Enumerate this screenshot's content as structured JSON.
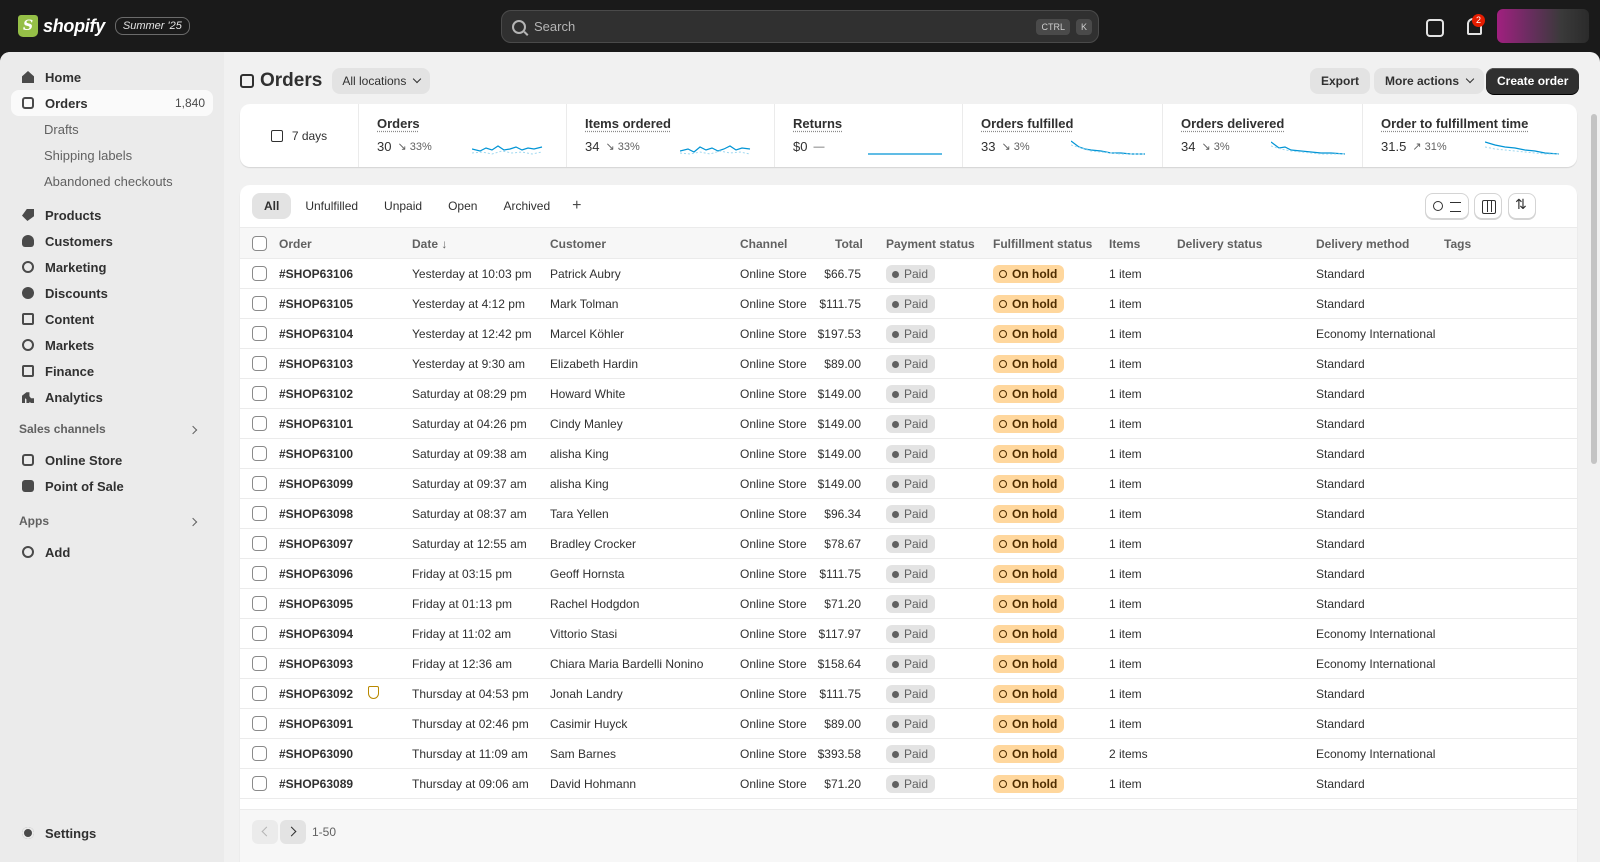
{
  "topbar": {
    "brand": "shopify",
    "edition": "Summer '25",
    "search_placeholder": "Search",
    "kbd_ctrl": "CTRL",
    "kbd_k": "K",
    "notification_count": "2"
  },
  "sidebar": {
    "home": "Home",
    "orders": "Orders",
    "orders_count": "1,840",
    "drafts": "Drafts",
    "shipping_labels": "Shipping labels",
    "abandoned": "Abandoned checkouts",
    "products": "Products",
    "customers": "Customers",
    "marketing": "Marketing",
    "discounts": "Discounts",
    "content": "Content",
    "markets": "Markets",
    "finance": "Finance",
    "analytics": "Analytics",
    "sales_channels": "Sales channels",
    "online_store": "Online Store",
    "pos": "Point of Sale",
    "apps": "Apps",
    "add": "Add",
    "settings": "Settings"
  },
  "page": {
    "title": "Orders",
    "location": "All locations",
    "export": "Export",
    "more_actions": "More actions",
    "create_order": "Create order"
  },
  "metrics": {
    "range": "7 days",
    "items": [
      {
        "label": "Orders",
        "value": "30",
        "delta": "↘ 33%"
      },
      {
        "label": "Items ordered",
        "value": "34",
        "delta": "↘ 33%"
      },
      {
        "label": "Returns",
        "value": "$0",
        "delta": "—"
      },
      {
        "label": "Orders fulfilled",
        "value": "33",
        "delta": "↘ 3%"
      },
      {
        "label": "Orders delivered",
        "value": "34",
        "delta": "↘ 3%"
      },
      {
        "label": "Order to fulfillment time",
        "value": "31.5",
        "delta": "↗ 31%"
      }
    ]
  },
  "tabs": [
    "All",
    "Unfulfilled",
    "Unpaid",
    "Open",
    "Archived",
    "+"
  ],
  "columns": {
    "order": "Order",
    "date": "Date ↓",
    "customer": "Customer",
    "channel": "Channel",
    "total": "Total",
    "payment": "Payment status",
    "fulfillment": "Fulfillment status",
    "items": "Items",
    "delivery_status": "Delivery status",
    "delivery_method": "Delivery method",
    "tags": "Tags"
  },
  "orders": [
    {
      "order": "#SHOP63106",
      "date": "Yesterday at 10:03 pm",
      "customer": "Patrick Aubry",
      "channel": "Online Store",
      "total": "$66.75",
      "payment": "Paid",
      "fulfillment": "On hold",
      "items": "1 item",
      "method": "Standard",
      "risk": false
    },
    {
      "order": "#SHOP63105",
      "date": "Yesterday at 4:12 pm",
      "customer": "Mark Tolman",
      "channel": "Online Store",
      "total": "$111.75",
      "payment": "Paid",
      "fulfillment": "On hold",
      "items": "1 item",
      "method": "Standard",
      "risk": false
    },
    {
      "order": "#SHOP63104",
      "date": "Yesterday at 12:42 pm",
      "customer": "Marcel Köhler",
      "channel": "Online Store",
      "total": "$197.53",
      "payment": "Paid",
      "fulfillment": "On hold",
      "items": "1 item",
      "method": "Economy International",
      "risk": false
    },
    {
      "order": "#SHOP63103",
      "date": "Yesterday at 9:30 am",
      "customer": "Elizabeth Hardin",
      "channel": "Online Store",
      "total": "$89.00",
      "payment": "Paid",
      "fulfillment": "On hold",
      "items": "1 item",
      "method": "Standard",
      "risk": false
    },
    {
      "order": "#SHOP63102",
      "date": "Saturday at 08:29 pm",
      "customer": "Howard White",
      "channel": "Online Store",
      "total": "$149.00",
      "payment": "Paid",
      "fulfillment": "On hold",
      "items": "1 item",
      "method": "Standard",
      "risk": false
    },
    {
      "order": "#SHOP63101",
      "date": "Saturday at 04:26 pm",
      "customer": "Cindy Manley",
      "channel": "Online Store",
      "total": "$149.00",
      "payment": "Paid",
      "fulfillment": "On hold",
      "items": "1 item",
      "method": "Standard",
      "risk": false
    },
    {
      "order": "#SHOP63100",
      "date": "Saturday at 09:38 am",
      "customer": "alisha King",
      "channel": "Online Store",
      "total": "$149.00",
      "payment": "Paid",
      "fulfillment": "On hold",
      "items": "1 item",
      "method": "Standard",
      "risk": false
    },
    {
      "order": "#SHOP63099",
      "date": "Saturday at 09:37 am",
      "customer": "alisha King",
      "channel": "Online Store",
      "total": "$149.00",
      "payment": "Paid",
      "fulfillment": "On hold",
      "items": "1 item",
      "method": "Standard",
      "risk": false
    },
    {
      "order": "#SHOP63098",
      "date": "Saturday at 08:37 am",
      "customer": "Tara Yellen",
      "channel": "Online Store",
      "total": "$96.34",
      "payment": "Paid",
      "fulfillment": "On hold",
      "items": "1 item",
      "method": "Standard",
      "risk": false
    },
    {
      "order": "#SHOP63097",
      "date": "Saturday at 12:55 am",
      "customer": "Bradley Crocker",
      "channel": "Online Store",
      "total": "$78.67",
      "payment": "Paid",
      "fulfillment": "On hold",
      "items": "1 item",
      "method": "Standard",
      "risk": false
    },
    {
      "order": "#SHOP63096",
      "date": "Friday at 03:15 pm",
      "customer": "Geoff Hornsta",
      "channel": "Online Store",
      "total": "$111.75",
      "payment": "Paid",
      "fulfillment": "On hold",
      "items": "1 item",
      "method": "Standard",
      "risk": false
    },
    {
      "order": "#SHOP63095",
      "date": "Friday at 01:13 pm",
      "customer": "Rachel Hodgdon",
      "channel": "Online Store",
      "total": "$71.20",
      "payment": "Paid",
      "fulfillment": "On hold",
      "items": "1 item",
      "method": "Standard",
      "risk": false
    },
    {
      "order": "#SHOP63094",
      "date": "Friday at 11:02 am",
      "customer": "Vittorio Stasi",
      "channel": "Online Store",
      "total": "$117.97",
      "payment": "Paid",
      "fulfillment": "On hold",
      "items": "1 item",
      "method": "Economy International",
      "risk": false
    },
    {
      "order": "#SHOP63093",
      "date": "Friday at 12:36 am",
      "customer": "Chiara Maria Bardelli Nonino",
      "channel": "Online Store",
      "total": "$158.64",
      "payment": "Paid",
      "fulfillment": "On hold",
      "items": "1 item",
      "method": "Economy International",
      "risk": false
    },
    {
      "order": "#SHOP63092",
      "date": "Thursday at 04:53 pm",
      "customer": "Jonah Landry",
      "channel": "Online Store",
      "total": "$111.75",
      "payment": "Paid",
      "fulfillment": "On hold",
      "items": "1 item",
      "method": "Standard",
      "risk": true
    },
    {
      "order": "#SHOP63091",
      "date": "Thursday at 02:46 pm",
      "customer": "Casimir Huyck",
      "channel": "Online Store",
      "total": "$89.00",
      "payment": "Paid",
      "fulfillment": "On hold",
      "items": "1 item",
      "method": "Standard",
      "risk": false
    },
    {
      "order": "#SHOP63090",
      "date": "Thursday at 11:09 am",
      "customer": "Sam Barnes",
      "channel": "Online Store",
      "total": "$393.58",
      "payment": "Paid",
      "fulfillment": "On hold",
      "items": "2 items",
      "method": "Economy International",
      "risk": false
    },
    {
      "order": "#SHOP63089",
      "date": "Thursday at 09:06 am",
      "customer": "David Hohmann",
      "channel": "Online Store",
      "total": "$71.20",
      "payment": "Paid",
      "fulfillment": "On hold",
      "items": "1 item",
      "method": "Standard",
      "risk": false
    }
  ],
  "pagination": {
    "range": "1-50"
  },
  "icons": {
    "search": "search-icon",
    "store": "store-icon",
    "bell": "bell-icon",
    "calendar": "calendar-icon",
    "risk": "shield-alert-icon"
  },
  "colors": {
    "on_hold_bg": "#ffd79d",
    "paid_bg": "#e3e3e3",
    "sparkline": "#0094d5",
    "primary_button": "#303030"
  }
}
